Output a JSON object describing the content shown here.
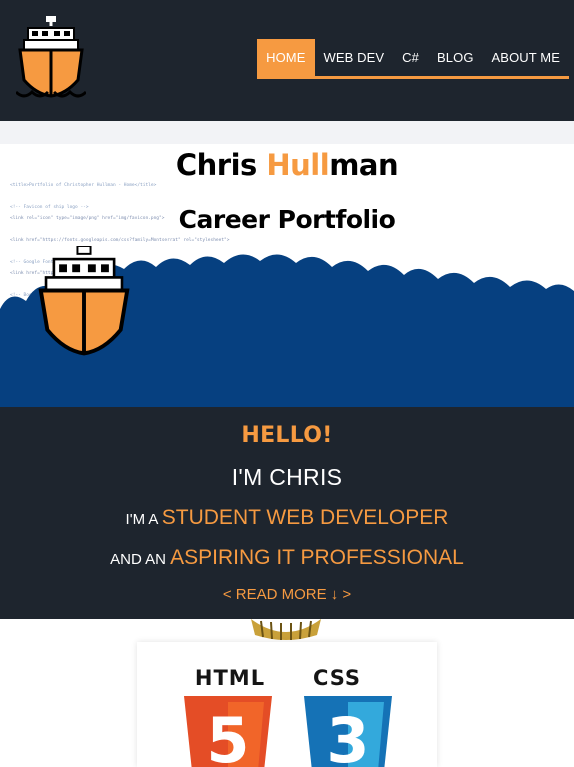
{
  "nav": {
    "items": [
      {
        "label": "HOME",
        "active": true
      },
      {
        "label": "WEB DEV",
        "active": false
      },
      {
        "label": "C#",
        "active": false
      },
      {
        "label": "BLOG",
        "active": false
      },
      {
        "label": "ABOUT ME",
        "active": false
      }
    ]
  },
  "hero": {
    "title_first": "Chris ",
    "title_accent": "Hull",
    "title_last": "man",
    "subtitle": "Career Portfolio"
  },
  "intro": {
    "hello": "HELLO!",
    "im_chris": "I'M CHRIS",
    "line3_prefix": "I'M A ",
    "line3_highlight": "STUDENT WEB DEVELOPER",
    "line4_prefix": "AND AN ",
    "line4_highlight": "ASPIRING IT PROFESSIONAL",
    "read_more": "< READ MORE ↓ >"
  },
  "skills": {
    "badges": [
      {
        "label": "HTML",
        "digit": "5",
        "color": "#e44d26"
      },
      {
        "label": "CSS",
        "digit": "3",
        "color": "#1572b6"
      }
    ]
  },
  "colors": {
    "accent": "#f69a41",
    "dark": "#1e252e",
    "wave": "#064080"
  }
}
